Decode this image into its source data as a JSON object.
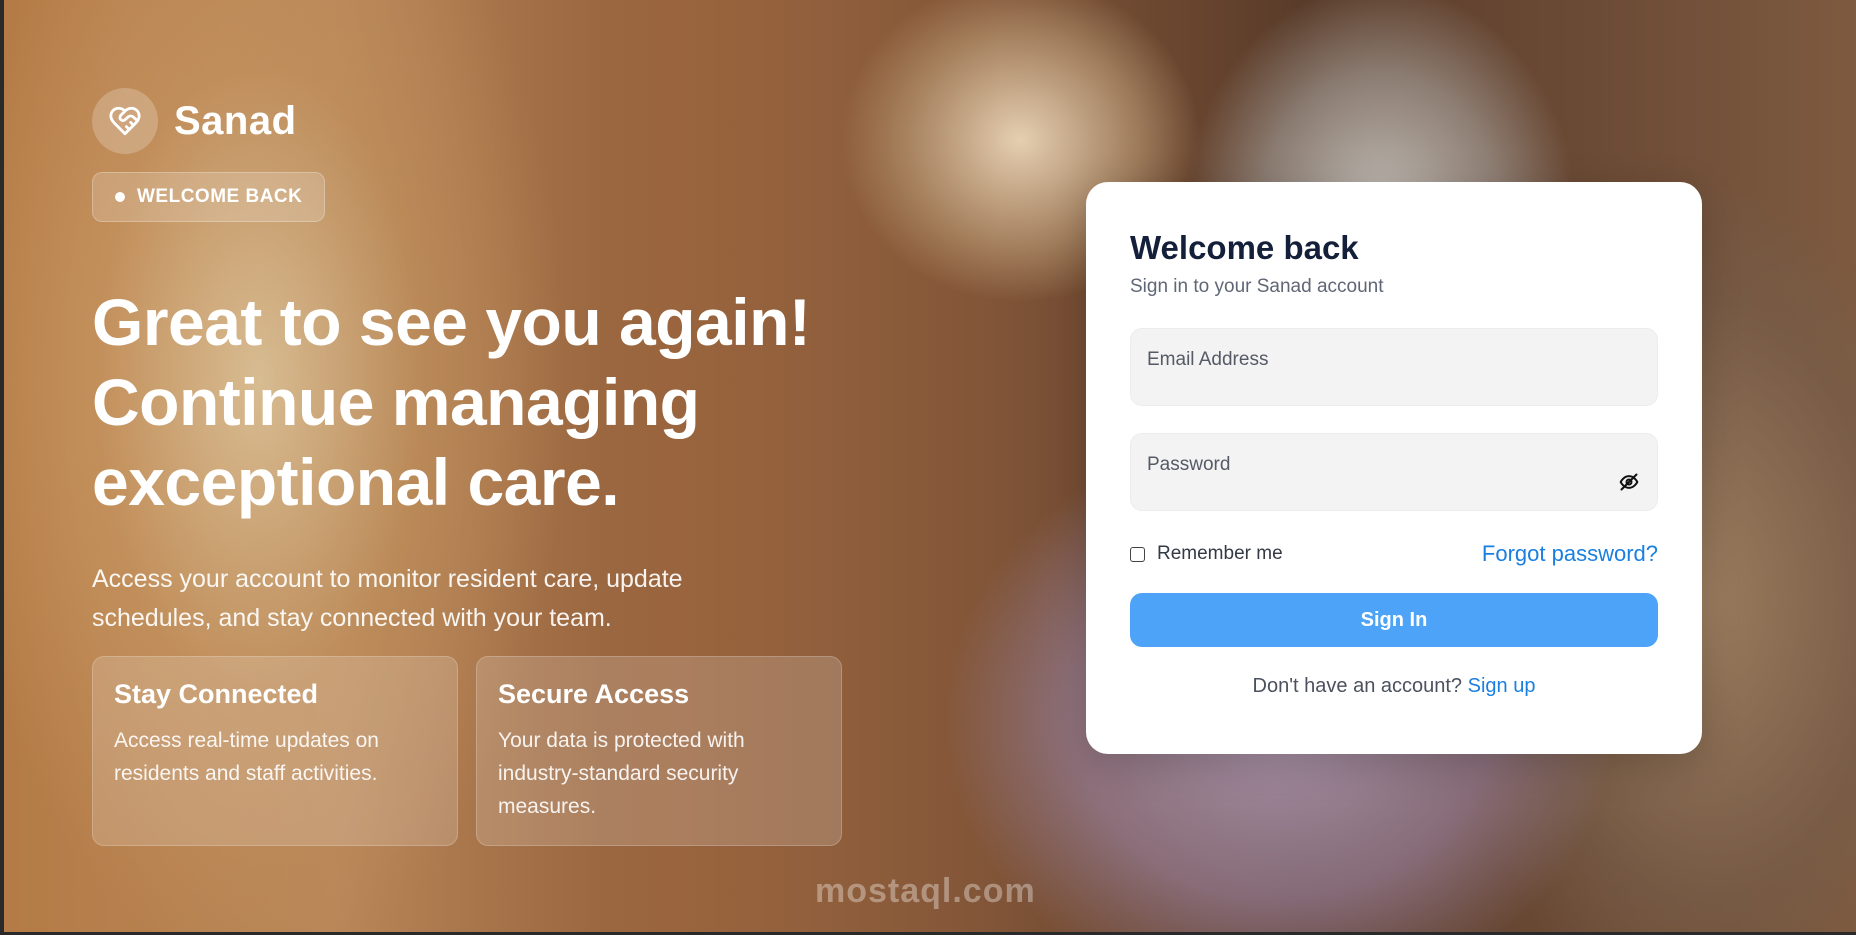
{
  "brand": {
    "name": "Sanad",
    "logo_icon": "heart-handshake-icon"
  },
  "badge": {
    "label": "WELCOME BACK"
  },
  "hero": {
    "headline_lines": [
      "Great to see you again!",
      "Continue managing",
      "exceptional care."
    ],
    "lead": "Access your account to monitor resident care, update schedules, and stay connected with your team."
  },
  "features": [
    {
      "title": "Stay Connected",
      "text": "Access real-time updates on residents and staff activities."
    },
    {
      "title": "Secure Access",
      "text": "Your data is protected with industry-standard security measures."
    }
  ],
  "watermark": "mostaql.com",
  "login": {
    "title": "Welcome back",
    "subtitle": "Sign in to your Sanad account",
    "email": {
      "placeholder": "Email Address",
      "value": ""
    },
    "password": {
      "placeholder": "Password",
      "value": "",
      "toggle_icon": "eye-off-icon"
    },
    "remember_label": "Remember me",
    "remember_checked": false,
    "forgot_label": "Forgot password?",
    "submit_label": "Sign In",
    "signup_prompt": "Don't have an account?",
    "signup_label": "Sign up"
  },
  "colors": {
    "accent": "#4ca3f7",
    "link": "#1a7fe0",
    "title": "#14203a"
  }
}
